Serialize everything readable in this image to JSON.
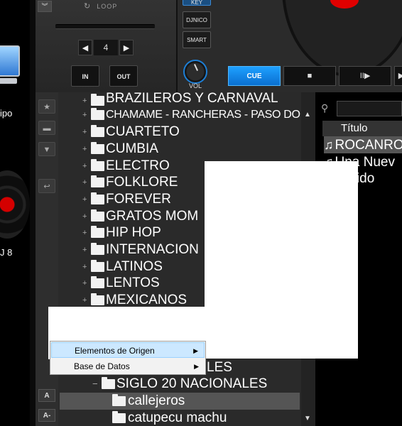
{
  "desktop": {
    "computer_label": "ipo",
    "app_label": "J 8"
  },
  "deck": {
    "loop_label": "LOOP",
    "loop_value": "4",
    "in_label": "IN",
    "out_label": "OUT",
    "key_label": "KEY",
    "djnico_label": "DJNICO",
    "smart_label": "SMART",
    "vol_label": "VOL",
    "cue_label": "CUE",
    "stop_symbol": "■",
    "play_pause_symbol": "II▶",
    "next_symbol": "▶"
  },
  "tree": {
    "rows": [
      {
        "label": "BRAZILEROS Y CARNAVAL",
        "level": 1
      },
      {
        "label": "CHAMAME - RANCHERAS - PASO DOBLE",
        "level": 1
      },
      {
        "label": "CUARTETO",
        "level": 1
      },
      {
        "label": "CUMBIA",
        "level": 1
      },
      {
        "label": "ELECTRO",
        "level": 1
      },
      {
        "label": "FOLKLORE",
        "level": 1
      },
      {
        "label": "FOREVER",
        "level": 1
      },
      {
        "label": "GRATOS MOM",
        "level": 1
      },
      {
        "label": "HIP HOP",
        "level": 1
      },
      {
        "label": "INTERNACION",
        "level": 1
      },
      {
        "label": "LATINOS",
        "level": 1
      },
      {
        "label": "LENTOS",
        "level": 1
      },
      {
        "label": "MEXICANOS",
        "level": 1
      },
      {
        "label": "LES",
        "level": 1
      },
      {
        "label": "SIGLO 20 NACIONALES",
        "level": 2
      },
      {
        "label": "callejeros",
        "level": 3
      },
      {
        "label": "catupecu machu",
        "level": 3
      }
    ]
  },
  "filelist": {
    "column_title": "Título",
    "rows": [
      "ROCANROL",
      "Una Nuev",
      "ohibido"
    ]
  },
  "context_menu": {
    "items": [
      {
        "label": "Elementos de Origen"
      },
      {
        "label": "Base de Datos"
      }
    ]
  },
  "sidebar": {
    "font_up": "A",
    "font_down": "A-"
  }
}
